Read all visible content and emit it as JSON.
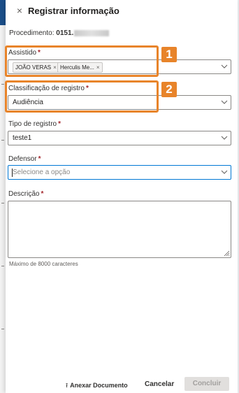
{
  "header": {
    "title": "Registrar informação",
    "close_glyph": "×"
  },
  "procedimento": {
    "label": "Procedimento:",
    "value": "0151."
  },
  "fields": {
    "assistido": {
      "label": "Assistido",
      "required": "*",
      "chips": [
        {
          "text": "JOÃO VERAS",
          "remove": "×"
        },
        {
          "text": "Herculis Me...",
          "remove": "×"
        }
      ]
    },
    "classificacao": {
      "label": "Classificação de registro",
      "required": "*",
      "value": "Audiência"
    },
    "tipo": {
      "label": "Tipo de registro",
      "required": "*",
      "value": "teste1"
    },
    "defensor": {
      "label": "Defensor",
      "required": "*",
      "placeholder": "Selecione a opção"
    },
    "descricao": {
      "label": "Descrição",
      "required": "*",
      "hint": "Máximo de 8000 caracteres"
    }
  },
  "footer": {
    "attach_label": "Anexar Documento",
    "cancel_label": "Cancelar",
    "conclude_label": "Concluir"
  },
  "annotations": {
    "badge_1": "1",
    "badge_2": "2",
    "color": "#e8842a"
  },
  "colors": {
    "required": "#a4262c",
    "focus": "#0078d4",
    "side_bar": "#1b4f8a"
  }
}
